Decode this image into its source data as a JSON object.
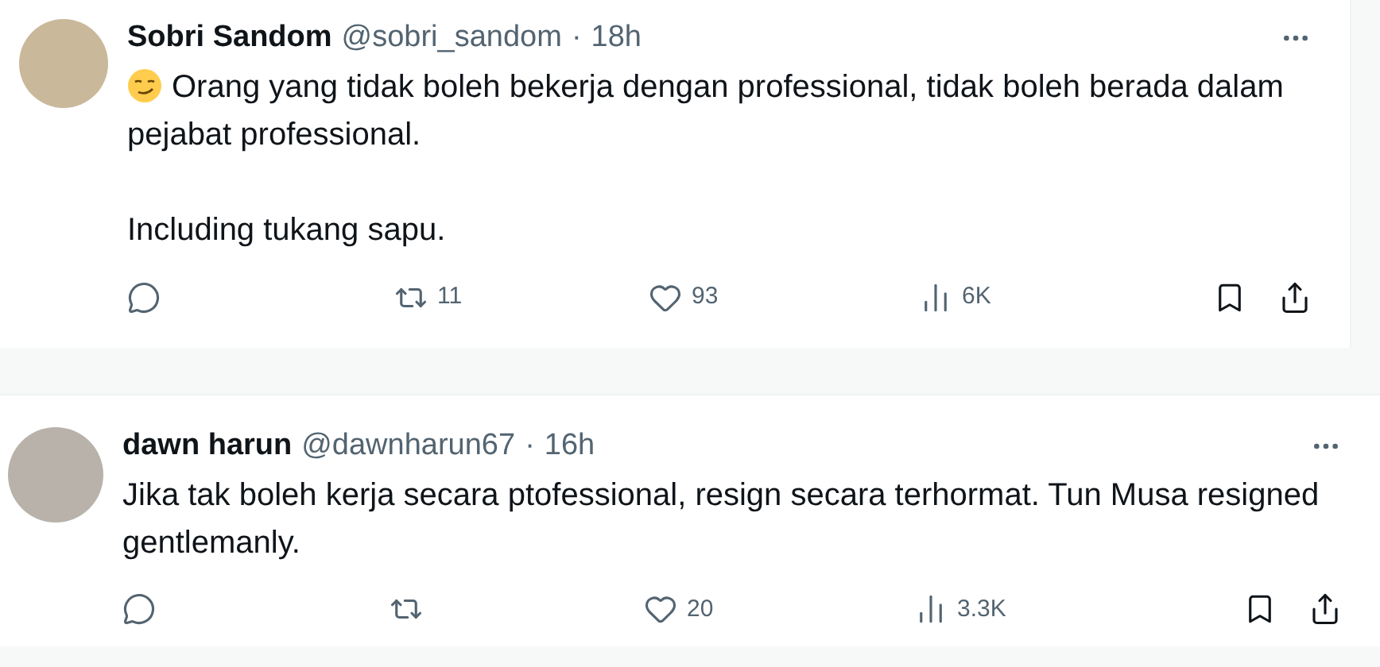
{
  "tweets": [
    {
      "author": "Sobri Sandom",
      "handle": "@sobri_sandom",
      "separator": "·",
      "time": "18h",
      "has_emoji": true,
      "paragraphs": [
        "Orang yang tidak boleh bekerja dengan professional, tidak boleh berada dalam pejabat professional.",
        "Including tukang sapu."
      ],
      "stats": {
        "retweets": "11",
        "likes": "93",
        "views": "6K"
      }
    },
    {
      "author": "dawn harun",
      "handle": "@dawnharun67",
      "separator": "·",
      "time": "16h",
      "has_emoji": false,
      "paragraphs": [
        "Jika tak boleh kerja secara ptofessional, resign secara terhormat. Tun Musa resigned gentlemanly."
      ],
      "stats": {
        "likes": "20",
        "views": "3.3K"
      }
    }
  ]
}
